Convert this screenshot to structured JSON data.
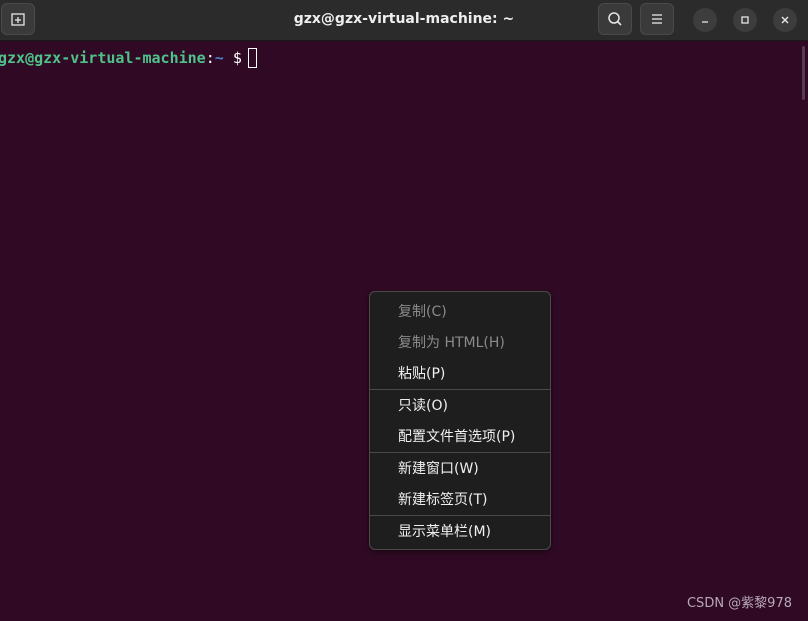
{
  "window": {
    "title": "gzx@gzx-virtual-machine: ~",
    "new_tab_icon": "new-tab-icon",
    "search_icon": "search-icon",
    "menu_icon": "hamburger-menu-icon"
  },
  "terminal": {
    "user_host": "gzx@gzx-virtual-machine",
    "separator": ":",
    "path": "~",
    "prompt_symbol": "$",
    "background": "#300a24"
  },
  "context_menu": {
    "items": [
      {
        "label": "复制(C)",
        "enabled": false
      },
      {
        "label": "复制为 HTML(H)",
        "enabled": false
      },
      {
        "label": "粘贴(P)",
        "enabled": true
      },
      {
        "label": "只读(O)",
        "enabled": true
      },
      {
        "label": "配置文件首选项(P)",
        "enabled": true
      },
      {
        "label": "新建窗口(W)",
        "enabled": true
      },
      {
        "label": "新建标签页(T)",
        "enabled": true
      },
      {
        "label": "显示菜单栏(M)",
        "enabled": true
      }
    ]
  },
  "watermark": "CSDN @紫黎978"
}
